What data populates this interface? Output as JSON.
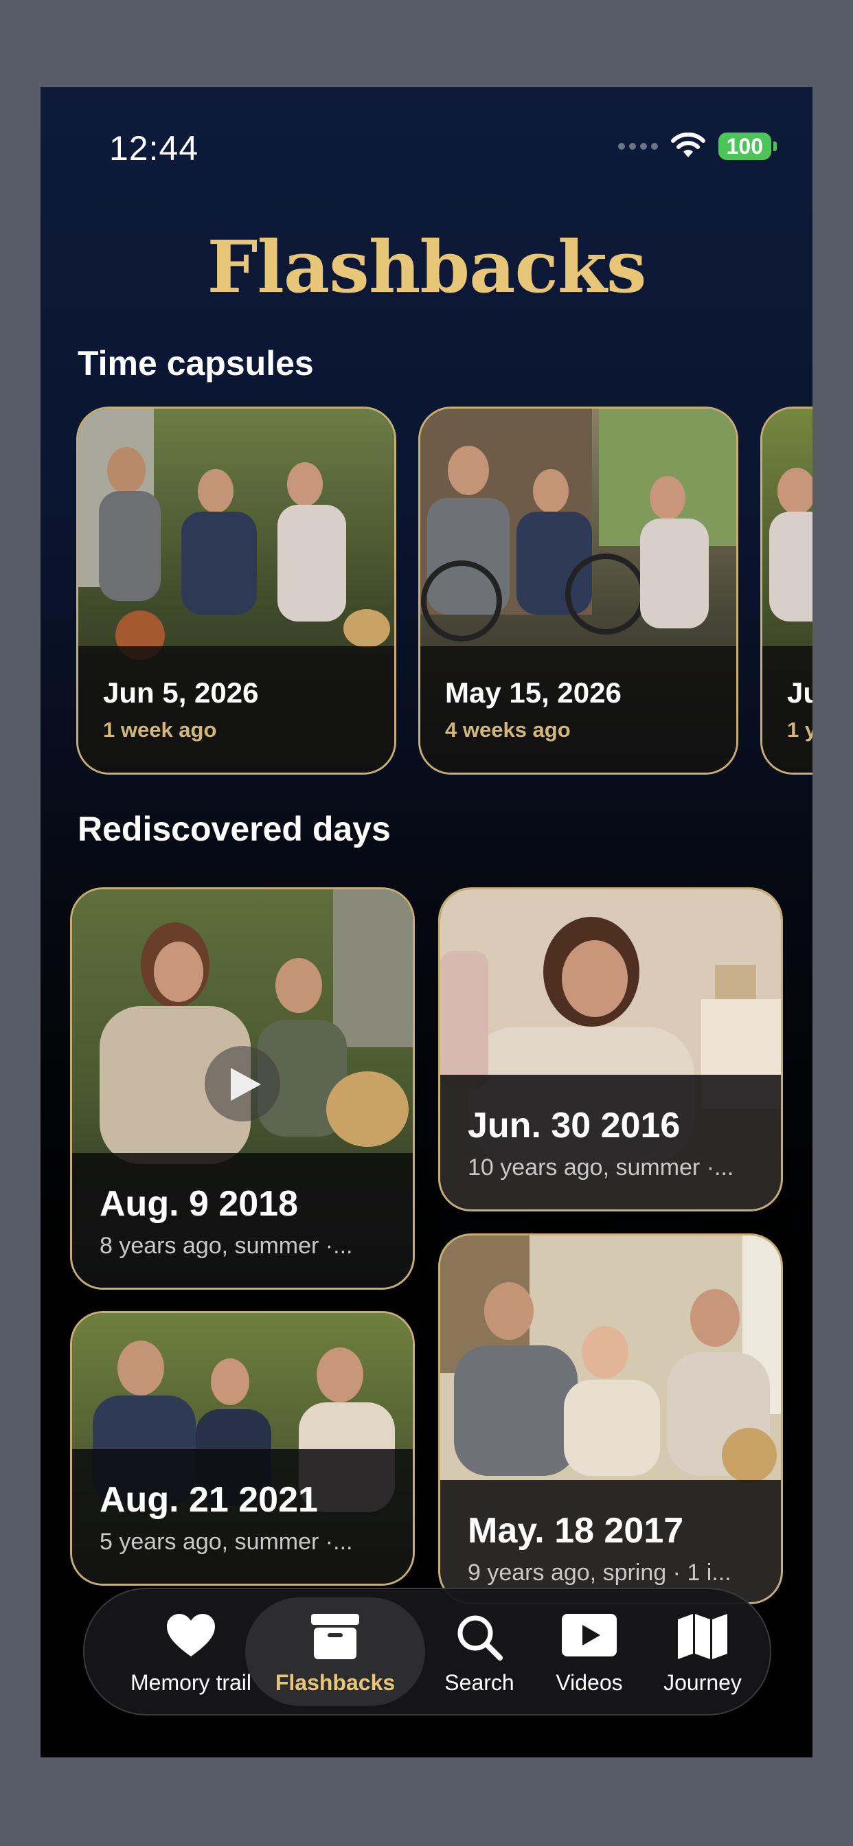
{
  "status": {
    "time": "12:44",
    "battery": "100"
  },
  "title": "Flashbacks",
  "time_capsules": {
    "heading": "Time capsules",
    "items": [
      {
        "date": "Jun 5, 2026",
        "ago": "1 week ago"
      },
      {
        "date": "May 15, 2026",
        "ago": "4 weeks ago"
      },
      {
        "date": "Ju",
        "ago": "1 y"
      }
    ]
  },
  "rediscovered": {
    "heading": "Rediscovered days",
    "items": [
      {
        "date": "Aug. 9 2018",
        "sub": "8 years ago, summer ·..."
      },
      {
        "date": "Jun. 30 2016",
        "sub": "10 years ago, summer ·..."
      },
      {
        "date": "Aug. 21 2021",
        "sub": "5 years ago, summer ·..."
      },
      {
        "date": "May. 18 2017",
        "sub": "9 years ago, spring · 1 i..."
      }
    ]
  },
  "tabs": [
    {
      "label": "Memory trail",
      "icon": "heart-icon"
    },
    {
      "label": "Flashbacks",
      "icon": "archive-box-icon",
      "active": true
    },
    {
      "label": "Search",
      "icon": "search-icon"
    },
    {
      "label": "Videos",
      "icon": "play-rectangle-icon"
    },
    {
      "label": "Journey",
      "icon": "map-icon"
    }
  ],
  "colors": {
    "accent": "#e7c777",
    "card_border": "#c8ae72",
    "battery": "#4cc45a"
  }
}
